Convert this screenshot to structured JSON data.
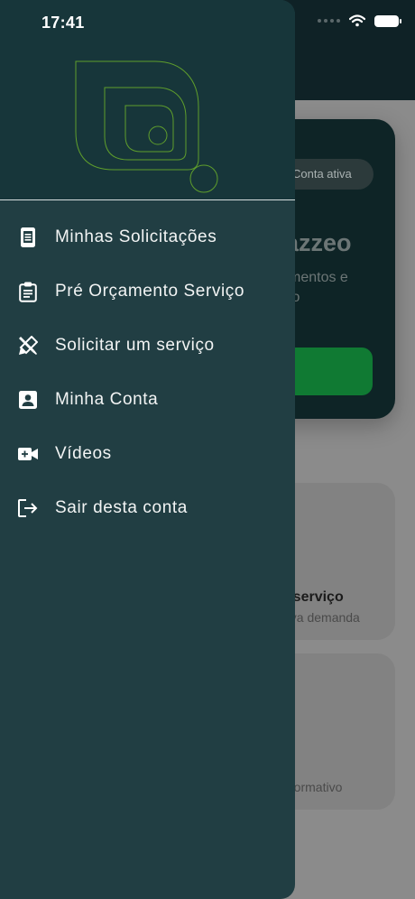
{
  "status_bar": {
    "time": "17:41"
  },
  "background": {
    "hero": {
      "badge": "Conta ativa",
      "brand_fragment": "azzeo",
      "desc_line1": "mentos e",
      "desc_line2": "lo"
    },
    "card1": {
      "title": "r serviço",
      "subtitle": "ova demanda"
    },
    "card2": {
      "subtitle": "nformativo"
    }
  },
  "drawer": {
    "menu": [
      {
        "label": "Minhas Solicitações",
        "icon": "document-icon"
      },
      {
        "label": "Pré Orçamento Serviço",
        "icon": "clipboard-icon"
      },
      {
        "label": "Solicitar um serviço",
        "icon": "tools-icon"
      },
      {
        "label": "Minha Conta",
        "icon": "account-icon"
      },
      {
        "label": "Vídeos",
        "icon": "video-icon"
      },
      {
        "label": "Sair desta conta",
        "icon": "logout-icon"
      }
    ]
  },
  "colors": {
    "drawer_bg": "#213e43",
    "drawer_header_bg": "#17363a",
    "logo_stroke": "#5f9e2c",
    "cta_green": "#107a33"
  }
}
